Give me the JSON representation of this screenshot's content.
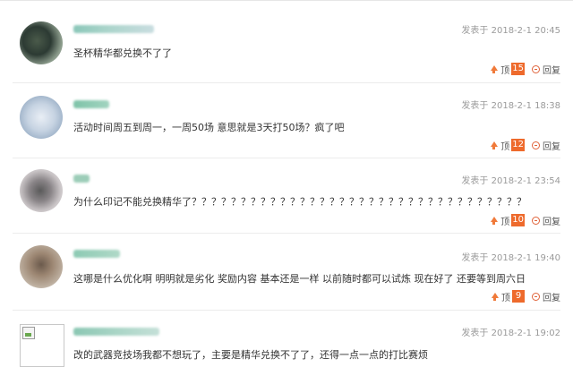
{
  "labels": {
    "posted_prefix": "发表于",
    "top": "顶",
    "reply": "回复"
  },
  "comments": [
    {
      "date": "2018-2-1 20:45",
      "text": "圣杯精华都兑换不了了",
      "likes": "15"
    },
    {
      "date": "2018-2-1 18:38",
      "text": "活动时间周五到周一，一周50场 意思就是3天打50场？疯了吧",
      "likes": "12"
    },
    {
      "date": "2018-2-1 23:54",
      "text": "为什么印记不能兑换精华了？？？？？？？？？？？？？？？？？？？？？？？？？？？？？？？？？？",
      "likes": "10"
    },
    {
      "date": "2018-2-1 19:40",
      "text": "这哪是什么优化啊 明明就是劣化  奖励内容 基本还是一样   以前随时都可以试炼  现在好了  还要等到周六日",
      "likes": "9"
    },
    {
      "date": "2018-2-1 19:02",
      "text": "改的武器竞技场我都不想玩了，主要是精华兑换不了了，还得一点一点的打比赛烦"
    }
  ],
  "colors": {
    "accent": "#ee6a2c",
    "date": "#9a9a9a",
    "text": "#333333"
  }
}
